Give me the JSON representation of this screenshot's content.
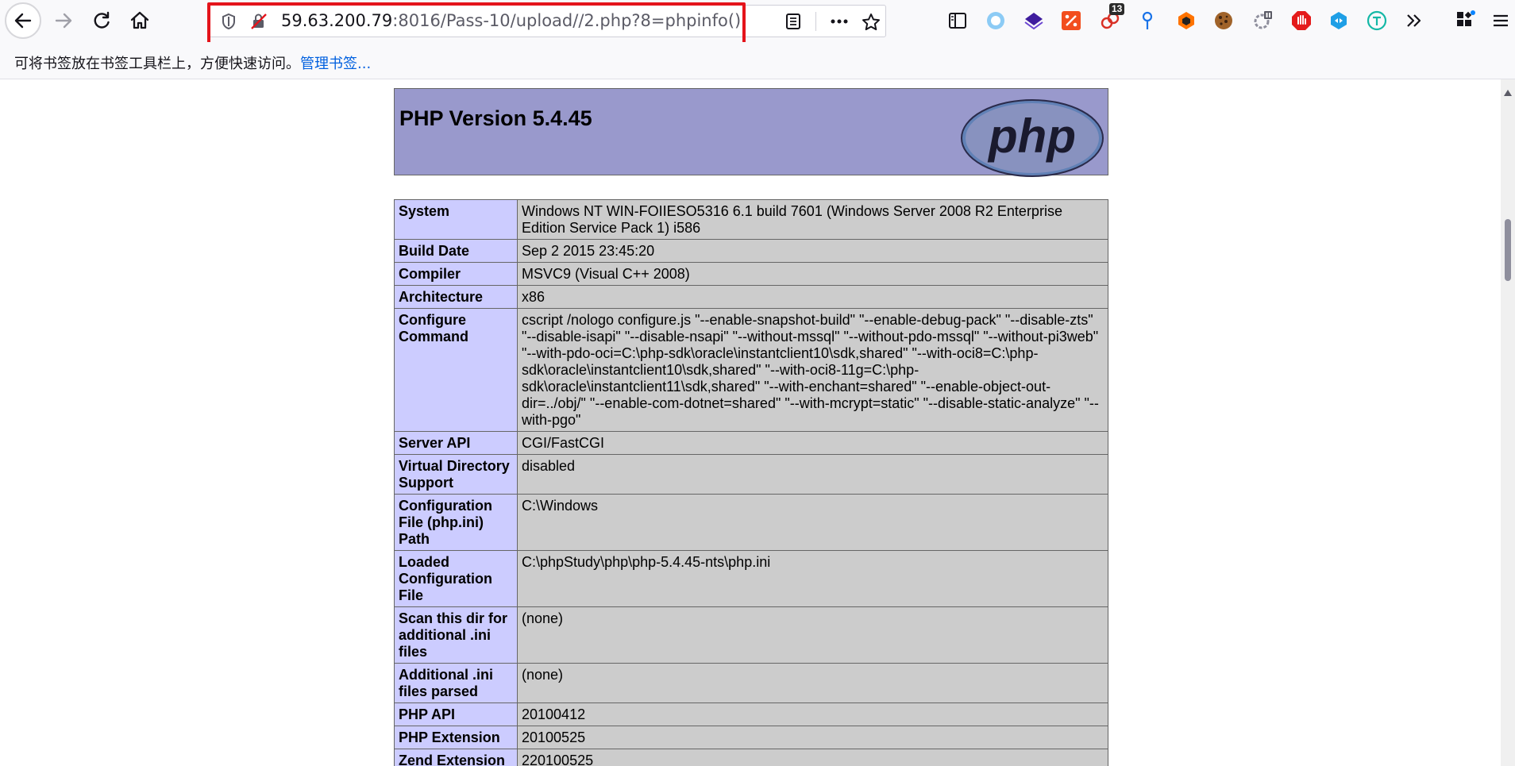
{
  "browser": {
    "url_host": "59.63.200.79",
    "url_rest": ":8016/Pass-10/upload//2.php?8=phpinfo();",
    "notification_badge": "13",
    "bookmarks_bar_text": "可将书签放在书签工具栏上，方便快速访问。",
    "bookmarks_bar_link": "管理书签..."
  },
  "icons": {
    "back": "back-arrow-icon",
    "forward": "forward-arrow-icon",
    "reload": "reload-icon",
    "home": "home-icon",
    "tracking": "shield-icon",
    "insecure": "insecure-lock-icon",
    "reader": "reader-view-icon",
    "menu_dots": "more-actions-icon",
    "bookmark_star": "star-icon",
    "sidebar": "sidebar-icon",
    "overflow": "overflow-chevron-icon",
    "extensions": "extensions-icon",
    "hamburger": "hamburger-menu-icon"
  },
  "php": {
    "title": "PHP Version 5.4.45",
    "logo_text": "php",
    "rows": [
      {
        "key": "System",
        "value": "Windows NT WIN-FOIIESO5316 6.1 build 7601 (Windows Server 2008 R2 Enterprise Edition Service Pack 1) i586"
      },
      {
        "key": "Build Date",
        "value": "Sep 2 2015 23:45:20"
      },
      {
        "key": "Compiler",
        "value": "MSVC9 (Visual C++ 2008)"
      },
      {
        "key": "Architecture",
        "value": "x86"
      },
      {
        "key": "Configure Command",
        "value": "cscript /nologo configure.js \"--enable-snapshot-build\" \"--enable-debug-pack\" \"--disable-zts\" \"--disable-isapi\" \"--disable-nsapi\" \"--without-mssql\" \"--without-pdo-mssql\" \"--without-pi3web\" \"--with-pdo-oci=C:\\php-sdk\\oracle\\instantclient10\\sdk,shared\" \"--with-oci8=C:\\php-sdk\\oracle\\instantclient10\\sdk,shared\" \"--with-oci8-11g=C:\\php-sdk\\oracle\\instantclient11\\sdk,shared\" \"--with-enchant=shared\" \"--enable-object-out-dir=../obj/\" \"--enable-com-dotnet=shared\" \"--with-mcrypt=static\" \"--disable-static-analyze\" \"--with-pgo\""
      },
      {
        "key": "Server API",
        "value": "CGI/FastCGI"
      },
      {
        "key": "Virtual Directory Support",
        "value": "disabled"
      },
      {
        "key": "Configuration File (php.ini) Path",
        "value": "C:\\Windows"
      },
      {
        "key": "Loaded Configuration File",
        "value": "C:\\phpStudy\\php\\php-5.4.45-nts\\php.ini"
      },
      {
        "key": "Scan this dir for additional .ini files",
        "value": "(none)"
      },
      {
        "key": "Additional .ini files parsed",
        "value": "(none)"
      },
      {
        "key": "PHP API",
        "value": "20100412"
      },
      {
        "key": "PHP Extension",
        "value": "20100525"
      },
      {
        "key": "Zend Extension",
        "value": "220100525"
      }
    ]
  },
  "colors": {
    "header_bg": "#9999cc",
    "key_bg": "#ccccff",
    "value_bg": "#cccccc",
    "highlight_border": "#e4141b",
    "link": "#0060df"
  }
}
